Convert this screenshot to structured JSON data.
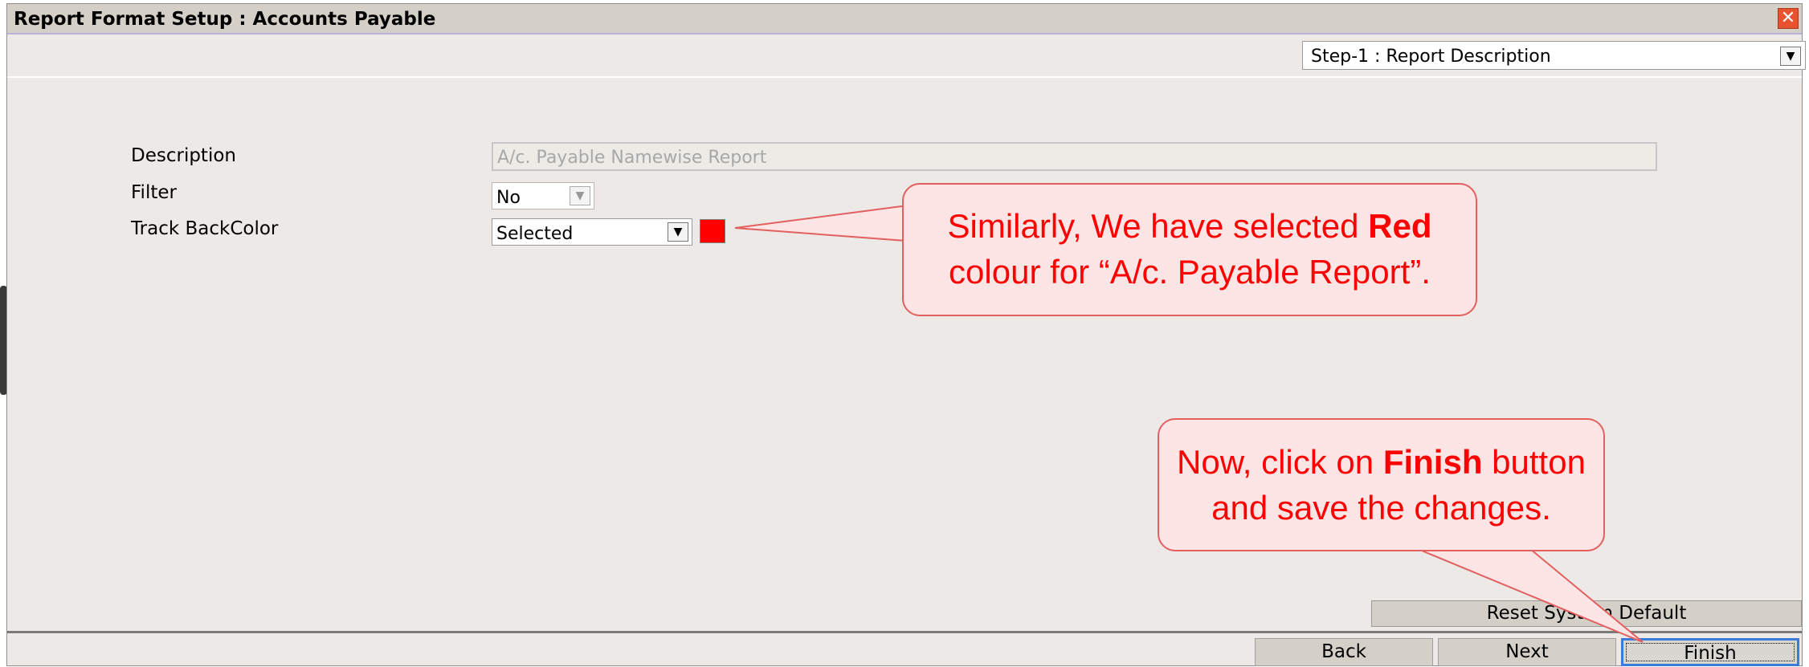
{
  "window": {
    "title": "Report Format Setup : Accounts Payable",
    "close_glyph": "✕"
  },
  "step_select": {
    "value": "Step-1 : Report Description",
    "arrow": "▼"
  },
  "form": {
    "description_label": "Description",
    "description_value": "A/c. Payable Namewise Report",
    "filter_label": "Filter",
    "filter_value": "No",
    "filter_arrow": "▼",
    "track_label": "Track BackColor",
    "track_value": "Selected",
    "track_arrow": "▼",
    "track_color": "#ff0000"
  },
  "callouts": {
    "first_line1_pre": "Similarly, We have selected ",
    "first_line1_bold": "Red",
    "first_line2": "colour for “A/c. Payable Report”.",
    "second_line1_pre": "Now, click on ",
    "second_line1_bold": "Finish",
    "second_line1_post": " button",
    "second_line2": "and save the changes."
  },
  "buttons": {
    "reset": "Reset System Default",
    "back": "Back",
    "next": "Next",
    "finish": "Finish"
  },
  "colors": {
    "callout_text": "#ff0000",
    "callout_fill": "#fde5e5",
    "callout_border": "#e26060",
    "finish_focus": "#3d7bd9"
  }
}
